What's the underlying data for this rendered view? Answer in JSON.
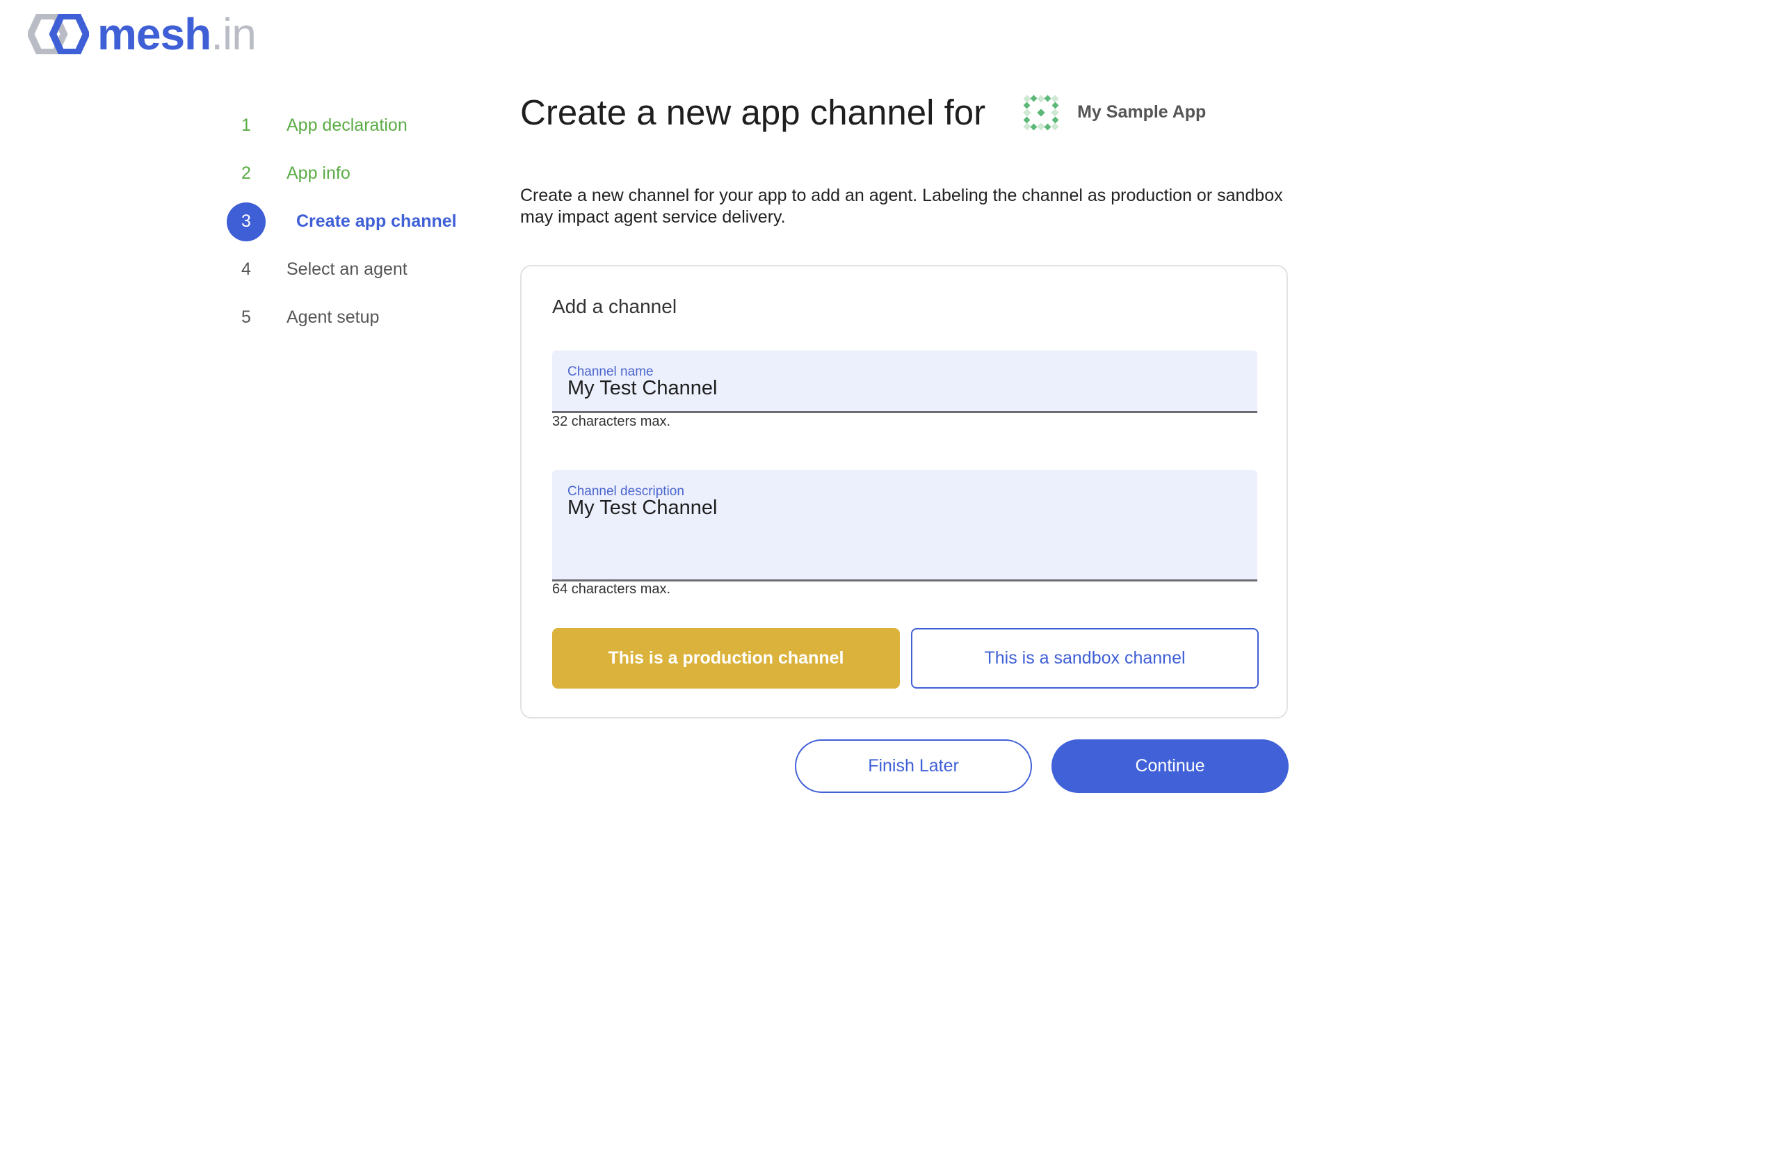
{
  "brand": {
    "logo_icon": "mesh-hexagon-logo-icon",
    "name_primary": "mesh",
    "name_secondary": ".in",
    "primary_color": "#3f5fd6",
    "secondary_color": "#b9bcc4"
  },
  "stepper": {
    "steps": [
      {
        "number": "1",
        "label": "App declaration",
        "state": "done"
      },
      {
        "number": "2",
        "label": "App info",
        "state": "done"
      },
      {
        "number": "3",
        "label": "Create app channel",
        "state": "active"
      },
      {
        "number": "4",
        "label": "Select an agent",
        "state": "pending"
      },
      {
        "number": "5",
        "label": "Agent setup",
        "state": "pending"
      }
    ],
    "done_color": "#5aac45",
    "active_color": "#3f5fd6"
  },
  "header": {
    "title": "Create a new app channel for",
    "app_icon": "sample-app-pattern-icon",
    "app_name": "My Sample App"
  },
  "intro_text": "Create a new channel for your app to add an agent.  Labeling the channel as production or sandbox may impact agent service delivery.",
  "card": {
    "title": "Add a channel",
    "channel_name": {
      "label": "Channel name",
      "value": "My Test Channel",
      "hint": "32 characters max."
    },
    "channel_description": {
      "label": "Channel description",
      "value": "My Test Channel",
      "hint": "64 characters max."
    },
    "production_button": "This is a production channel",
    "sandbox_button": "This is a sandbox channel",
    "production_color": "#dbb33c"
  },
  "actions": {
    "finish_later": "Finish Later",
    "continue": "Continue"
  }
}
